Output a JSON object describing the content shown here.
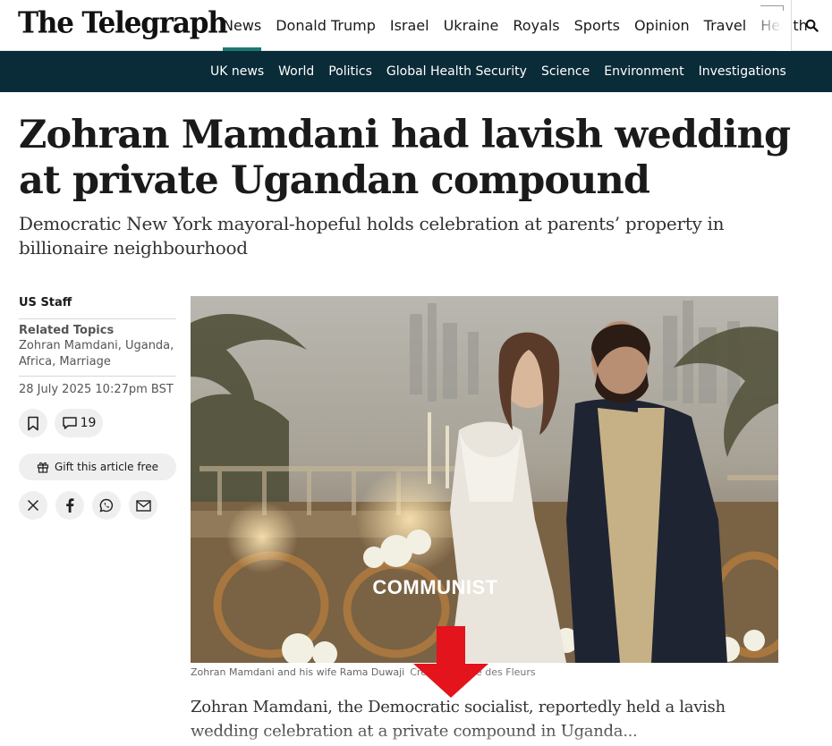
{
  "header": {
    "logo": "The Telegraph",
    "primary_nav": [
      {
        "label": "News",
        "active": true
      },
      {
        "label": "Donald Trump"
      },
      {
        "label": "Israel"
      },
      {
        "label": "Ukraine"
      },
      {
        "label": "Royals"
      },
      {
        "label": "Sports"
      },
      {
        "label": "Opinion"
      },
      {
        "label": "Travel"
      },
      {
        "label": "Health"
      }
    ],
    "search_icon": "search-icon",
    "accent_color": "#1c7a72"
  },
  "subnav": {
    "background": "#0a2b38",
    "items": [
      "UK news",
      "World",
      "Politics",
      "Global Health Security",
      "Science",
      "Environment",
      "Investigations"
    ]
  },
  "article": {
    "headline": "Zohran Mamdani had lavish wedding at private Ugandan compound",
    "standfirst": "Democratic New York mayoral-hopeful holds celebration at parents’ property in billionaire neighbourhood",
    "author": "US Staff",
    "related_heading": "Related Topics",
    "related_topics": "Zohran Mamdani, Uganda, Africa, Marriage",
    "published": "28 July 2025 10:27pm BST",
    "comment_count": "19",
    "gift_label": "Gift this article free",
    "share_icons": [
      "x-icon",
      "facebook-icon",
      "whatsapp-icon",
      "email-icon"
    ],
    "image_overlay_text": "COMMUNIST",
    "caption": "Zohran Mamdani and his wife Rama Duwaji",
    "caption_credit": "Credit: Marché des Fleurs",
    "body": "Zohran Mamdani, the Democratic socialist, reportedly held a lavish wedding celebration at a private compound in Uganda..."
  }
}
